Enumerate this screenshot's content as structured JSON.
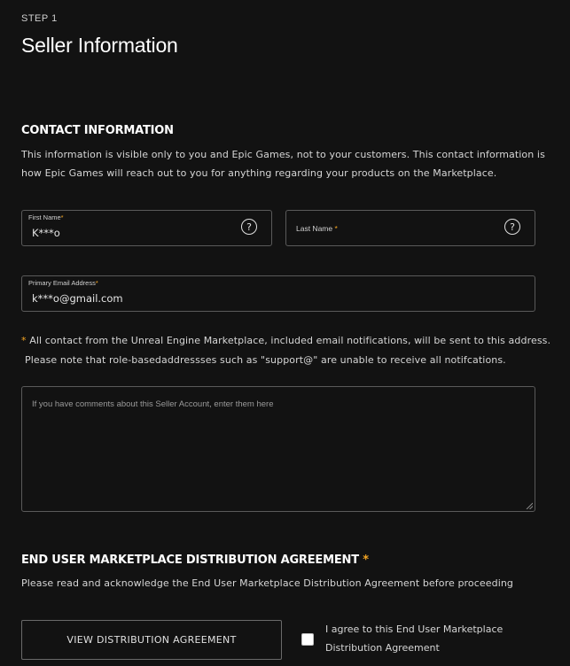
{
  "step": {
    "label": "STEP 1",
    "title": "Seller Information"
  },
  "contact": {
    "heading": "CONTACT INFORMATION",
    "description_line1": "This information is visible only to you and Epic Games, not to your customers. This contact information is",
    "description_line2": "how Epic Games will reach out to you for anything regarding your products on the Marketplace.",
    "first_name": {
      "label": "First Name",
      "required_mark": "*",
      "value": "K***o",
      "help_icon": "question-circle-icon"
    },
    "last_name": {
      "label": "Last Name",
      "required_mark": "*",
      "value": "",
      "help_icon": "question-circle-icon"
    },
    "email": {
      "label": "Primary Email Address",
      "required_mark": "*",
      "value": "k***o@gmail.com"
    },
    "note_mark": "*",
    "note_line1": "All contact from the Unreal Engine Marketplace, included email notifications, will be sent to this address.",
    "note_line2": "Please note that role-basedaddressses such as \"support@\" are unable to receive all notifcations.",
    "comments_placeholder": "If you have comments about this Seller Account, enter them here"
  },
  "agreement": {
    "heading": "END USER MARKETPLACE DISTRIBUTION AGREEMENT",
    "required_mark": "*",
    "description": "Please read and acknowledge the End User Marketplace Distribution Agreement before proceeding",
    "view_button_label": "VIEW DISTRIBUTION AGREEMENT",
    "checkbox_checked": false,
    "agree_line1": "I agree to this End User Marketplace",
    "agree_line2": "Distribution Agreement"
  },
  "colors": {
    "background": "#121212",
    "required_accent": "#f5a623",
    "border": "#5a5a5a"
  }
}
